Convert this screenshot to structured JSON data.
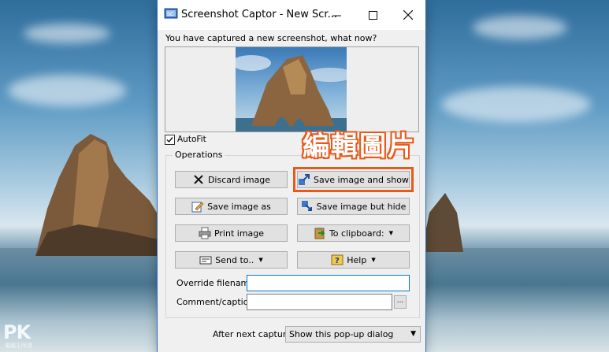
{
  "window": {
    "title": "Screenshot Captor - New Scr...",
    "prompt": "You have captured a new screenshot, what now?",
    "icons": {
      "app": "screenshot-captor-icon",
      "minimize": "minimize-icon",
      "maximize": "maximize-icon",
      "close": "close-icon"
    }
  },
  "autofit": {
    "label": "AutoFit",
    "checked": true
  },
  "overlay_label": "編輯圖片",
  "operations": {
    "title": "Operations",
    "buttons": {
      "discard": "Discard image",
      "save_and_show": "Save image and show",
      "save_as": "Save image as",
      "save_hide": "Save image but hide",
      "print": "Print image",
      "clipboard": "To clipboard:",
      "send_to": "Send to..",
      "help": "Help"
    }
  },
  "fields": {
    "override_filename_label": "Override filename:",
    "override_filename_value": "",
    "comment_label": "Comment/caption:",
    "comment_value": "",
    "comment_more": "..."
  },
  "after_capture": {
    "label": "After next capture:",
    "selected": "Show this pop-up dialog"
  },
  "watermark": {
    "brand": "PK",
    "sub": "電腦王阿達"
  },
  "colors": {
    "highlight": "#e8591a",
    "accent": "#0078d7",
    "window_bg": "#f0f0f0"
  }
}
